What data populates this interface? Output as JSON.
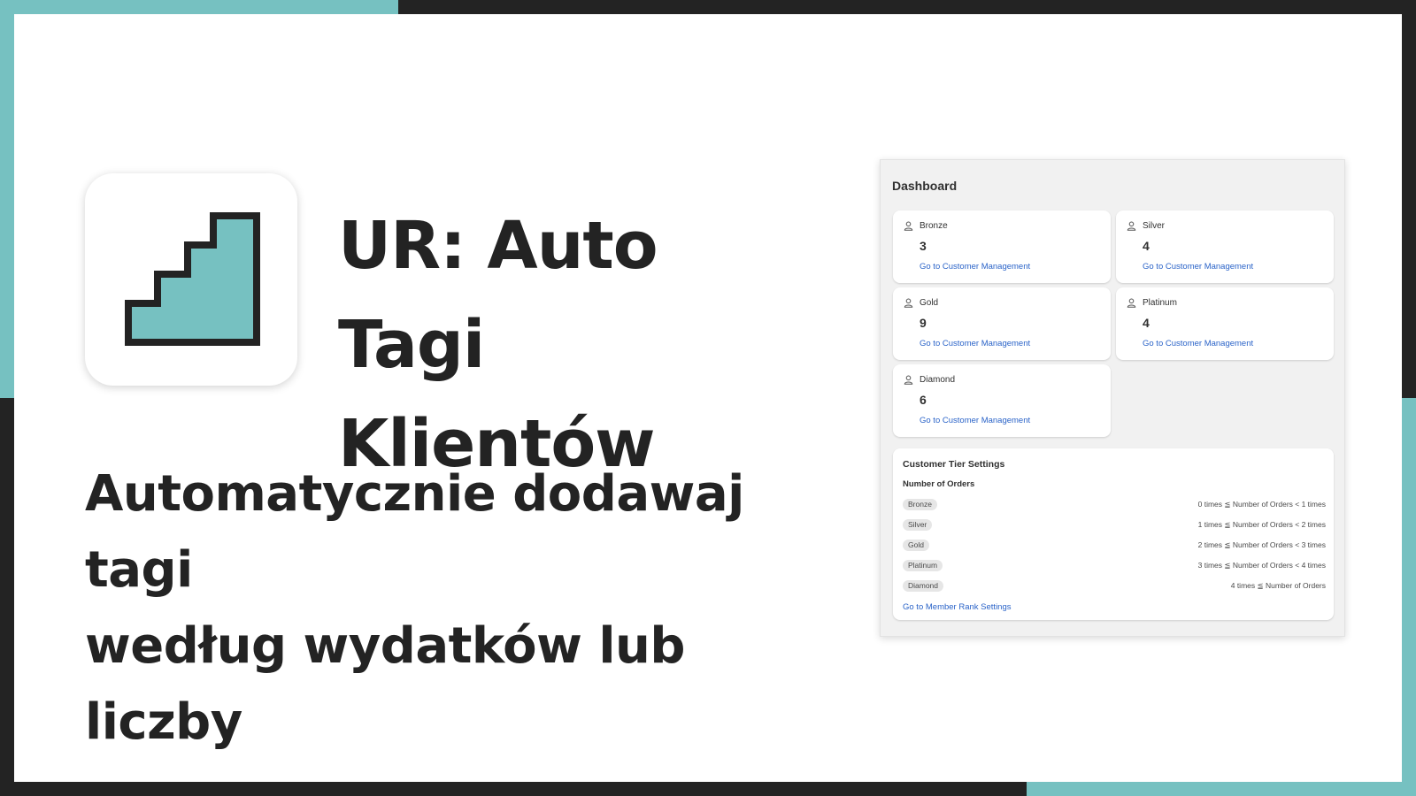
{
  "hero": {
    "title_line1": "UR: Auto Tagi",
    "title_line2": "Klientów",
    "subtitle_line1": "Automatycznie dodawaj tagi",
    "subtitle_line2": "według wydatków lub liczby"
  },
  "colors": {
    "accent": "#76c1c1",
    "dark": "#232323",
    "link": "#2a63c8"
  },
  "icons": {
    "app": "staircase-icon",
    "tier": "person-icon"
  },
  "dashboard": {
    "title": "Dashboard",
    "tiers": [
      {
        "name": "Bronze",
        "count": "3",
        "link": "Go to Customer Management"
      },
      {
        "name": "Silver",
        "count": "4",
        "link": "Go to Customer Management"
      },
      {
        "name": "Gold",
        "count": "9",
        "link": "Go to Customer Management"
      },
      {
        "name": "Platinum",
        "count": "4",
        "link": "Go to Customer Management"
      },
      {
        "name": "Diamond",
        "count": "6",
        "link": "Go to Customer Management"
      }
    ],
    "settings": {
      "title": "Customer Tier Settings",
      "subtitle": "Number of Orders",
      "rules": [
        {
          "tier": "Bronze",
          "rule": "0 times ≦ Number of Orders < 1 times"
        },
        {
          "tier": "Silver",
          "rule": "1 times ≦ Number of Orders < 2 times"
        },
        {
          "tier": "Gold",
          "rule": "2 times ≦ Number of Orders < 3 times"
        },
        {
          "tier": "Platinum",
          "rule": "3 times ≦ Number of Orders < 4 times"
        },
        {
          "tier": "Diamond",
          "rule": "4 times ≦ Number of Orders"
        }
      ],
      "link": "Go to Member Rank Settings"
    }
  }
}
